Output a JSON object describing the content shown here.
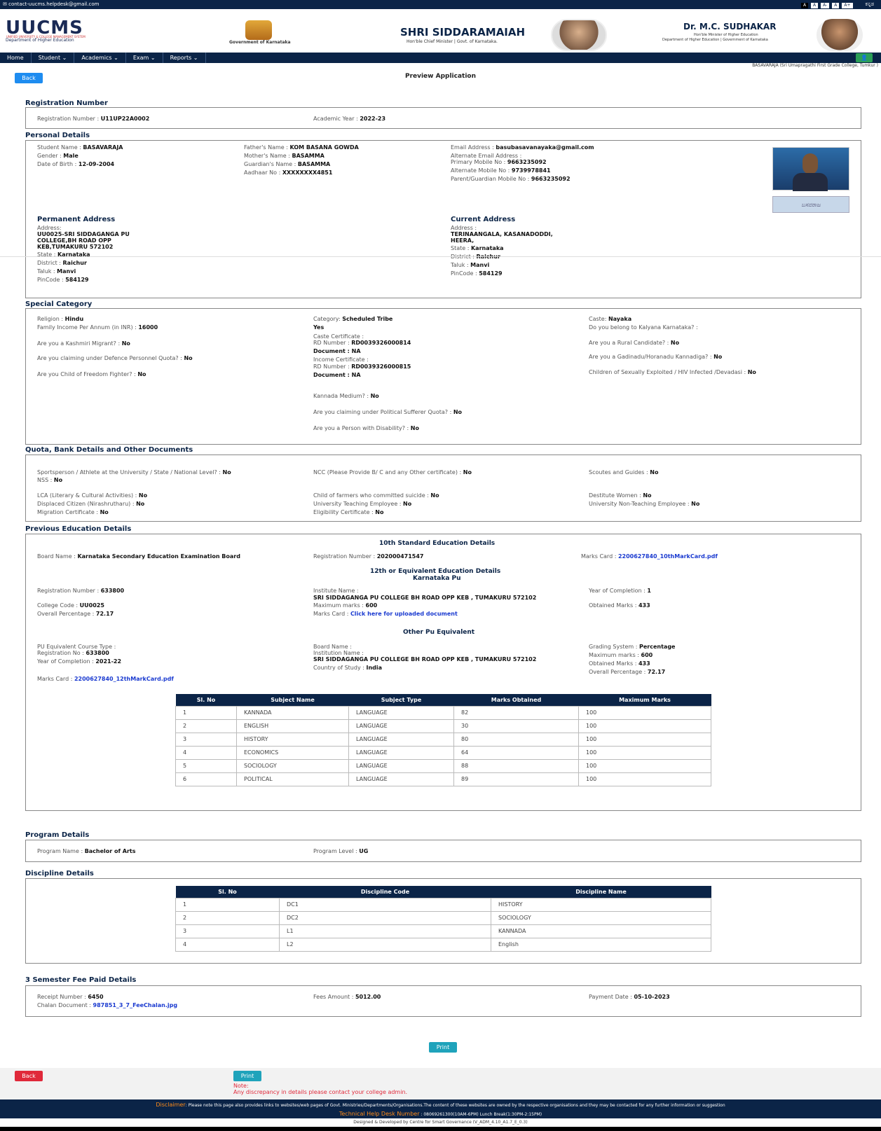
{
  "topbar": {
    "email": "✉ contact-uucms.helpdesk@gmail.com",
    "font_buttons": [
      "A",
      "A",
      "A",
      "A-",
      "A+"
    ],
    "language": "ಕನ್ನಡ"
  },
  "header": {
    "logo": "UUCMS",
    "logo_tag": "UNIFIED UNIVERSITY & COLLEGE MANAGEMENT SYSTEM",
    "logo_sub": "Department of Higher Education",
    "gov": "Government of Karnataka",
    "cm_name": "SHRI SIDDARAMAIAH",
    "cm_role": "Hon'ble Chief Minister  |  Govt. of Karnataka.",
    "min_name": "Dr. M.C. SUDHAKAR",
    "min_role1": "Hon'ble Minister of Higher Education",
    "min_role2": "Department of Higher Education | Government of Karnataka"
  },
  "nav": {
    "items": [
      "Home",
      "Student ⌄",
      "Academics ⌄",
      "Exam ⌄",
      "Reports ⌄"
    ],
    "user_icon": "👤"
  },
  "college": "BASAVARAJA (Sri Umapragathi First Grade College, Tumkur )",
  "back_label": "Back",
  "page_title": "Preview Application",
  "sections": {
    "reg": "Registration Number",
    "personal": "Personal Details",
    "special": "Special Category",
    "quota": "Quota, Bank Details and Other Documents",
    "prev": "Previous Education Details",
    "program": "Program Details",
    "discipline": "Discipline Details",
    "fee": "3 Semester Fee Paid Details"
  },
  "reg": {
    "reg_label": "Registration Number : ",
    "reg_value": "U11UP22A0002",
    "year_label": "Academic Year : ",
    "year_value": "2022-23"
  },
  "personal": {
    "student_label": "Student Name : ",
    "student_value": "BASAVARAJA",
    "gender_label": "Gender : ",
    "gender_value": "Male",
    "dob_label": "Date of Birth : ",
    "dob_value": "12-09-2004",
    "father_label": "Father's Name : ",
    "father_value": "KOM BASANA GOWDA",
    "mother_label": "Mother's Name : ",
    "mother_value": "BASAMMA",
    "guardian_label": "Guardian's Name : ",
    "guardian_value": "BASAMMA",
    "aadhaar_label": "Aadhaar No : ",
    "aadhaar_value": "XXXXXXXX4851",
    "email_label": "Email Address : ",
    "email_value": "basubasavanayaka@gmail.com",
    "alt_email_label": "Alternate Email Address :",
    "primary_label": "Primary Mobile No : ",
    "primary_value": "9663235092",
    "alt_mobile_label": "Alternate Mobile No : ",
    "alt_mobile_value": "9739978841",
    "parent_label": "Parent/Guardian Mobile No : ",
    "parent_value": "9663235092",
    "signature": "ಬಸವರಾಜ"
  },
  "permanent": {
    "heading": "Permanent Address",
    "address_label": "Address:",
    "line1": "UU0025-SRI SIDDAGANGA PU",
    "line2": "COLLEGE,BH ROAD OPP",
    "line3": "KEB,TUMAKURU 572102",
    "state_label": "State : ",
    "state": "Karnataka",
    "district_label": "District : ",
    "district": "Raichur",
    "taluk_label": "Taluk : ",
    "taluk": "Manvi",
    "pin_label": "PinCode : ",
    "pin": "584129"
  },
  "current": {
    "heading": "Current Address",
    "address_label": "Address :",
    "line1": "TERINAANGALA, KASANADODDI,",
    "line2": "HEERA,",
    "state_label": "State : ",
    "state": "Karnataka",
    "district_label": "District : ",
    "district": "Raichur",
    "taluk_label": "Taluk : ",
    "taluk": "Manvi",
    "pin_label": "PinCode : ",
    "pin": "584129"
  },
  "special": {
    "religion_label": "Religion : ",
    "religion": "Hindu",
    "income_label": "Family Income Per Annum (in INR) : ",
    "income": "16000",
    "kashmiri_label": "Are you a Kashmiri Migrant? : ",
    "kashmiri": "No",
    "defence_label": "Are you claiming under Defence Personnel Quota? : ",
    "defence": "No",
    "freedom_label": "Are you Child of Freedom Fighter? : ",
    "freedom": "No",
    "category_label": "Category: ",
    "category": "Scheduled Tribe",
    "yes": "Yes",
    "caste_cert": "Caste Certificate :",
    "rd_label": "RD Number : ",
    "rd1": "RD0039326000814",
    "doc_label": "Document : ",
    "doc_value": "NA",
    "income_cert": "Income Certificate :",
    "rd2": "RD0039326000815",
    "kannada_label": "Kannada Medium? : ",
    "kannada": "No",
    "political_label": "Are you claiming under Political Sufferer Quota? : ",
    "political": "No",
    "disability_label": "Are you a Person with Disability? : ",
    "disability": "No",
    "caste_label": "Caste: ",
    "caste": "Nayaka",
    "kalyana_label": "Do you belong to Kalyana Karnataka? :",
    "rural_label": "Are you a Rural Candidate? : ",
    "rural": "No",
    "gadinadu_label": "Are you a Gadinadu/Horanadu Kannadiga? : ",
    "gadinadu": "No",
    "exploited_label": "Children of Sexually Exploited / HIV Infected /Devadasi : ",
    "exploited": "No"
  },
  "quota": {
    "sports_label": "Sportsperson / Athlete at the University / State / National Level? : ",
    "sports": "No",
    "nss_label": "NSS : ",
    "nss": "No",
    "ncc_label": "NCC (Please Provide B/ C and any Other certificate) : ",
    "ncc": "No",
    "scouts_label": "Scoutes and Guides : ",
    "scouts": "No",
    "lca_label": "LCA (Literary & Cultural Activities) : ",
    "lca": "No",
    "displaced_label": "Displaced Citizen (Nirashrutharu) : ",
    "displaced": "No",
    "migration_label": "Migration Certificate : ",
    "migration": "No",
    "farmers_label": "Child of farmers who committed suicide : ",
    "farmers": "No",
    "teaching_label": "University Teaching Employee : ",
    "teaching": "No",
    "eligibility_label": "Eligibility Certificate : ",
    "eligibility": "No",
    "destitute_label": "Destitute Women : ",
    "destitute": "No",
    "nonteaching_label": "University Non-Teaching Employee : ",
    "nonteaching": "No"
  },
  "prev": {
    "tenth_heading": "10th Standard Education Details",
    "board_label": "Board Name : ",
    "board": "Karnataka Secondary Education Examination Board",
    "reg10_label": "Registration Number : ",
    "reg10": "202000471547",
    "marks10_label": "Marks Card : ",
    "marks10": "2200627840_10thMarkCard.pdf",
    "twelfth_heading": "12th or Equivalent Education Details",
    "twelfth_sub": "Karnataka Pu",
    "reg12_label": "Registration Number : ",
    "reg12": "633800",
    "college_code_label": "College Code : ",
    "college_code": "UU0025",
    "overall_label": "Overall Percentage : ",
    "overall": "72.17",
    "inst_label": "Institute Name :",
    "inst": "SRI SIDDAGANGA PU COLLEGE BH ROAD OPP KEB , TUMAKURU 572102",
    "max_label": "Maximum marks : ",
    "max": "600",
    "marks12_label": "Marks Card : ",
    "marks12": "Click here for uploaded document",
    "yoc_label": "Year of Completion : ",
    "yoc": "1",
    "obt_label": "Obtained Marks : ",
    "obt": "433",
    "other_heading": "Other Pu Equivalent",
    "pu_course_label": "PU Equivalent Course Type :",
    "regno_label": "Registration No : ",
    "regno": "633800",
    "yoc2_label": "Year of Completion : ",
    "yoc2": "2021-22",
    "marks_other_label": "Marks Card : ",
    "marks_other": "2200627840_12thMarkCard.pdf",
    "board2_label": "Board Name :",
    "inst2_label": "Institution Name :",
    "inst2": "SRI SIDDAGANGA PU COLLEGE BH ROAD OPP KEB , TUMAKURU 572102",
    "country_label": "Country of Study : ",
    "country": "India",
    "grading_label": "Grading System : ",
    "grading": "Percentage",
    "max2_label": "Maximum marks : ",
    "max2": "600",
    "obt2_label": "Obtained Marks : ",
    "obt2": "433",
    "overall2_label": "Overall Percentage : ",
    "overall2": "72.17",
    "table_headers": [
      "Sl. No",
      "Subject Name",
      "Subject Type",
      "Marks Obtained",
      "Maximum Marks"
    ],
    "rows": [
      [
        "1",
        "KANNADA",
        "LANGUAGE",
        "82",
        "100"
      ],
      [
        "2",
        "ENGLISH",
        "LANGUAGE",
        "30",
        "100"
      ],
      [
        "3",
        "HISTORY",
        "LANGUAGE",
        "80",
        "100"
      ],
      [
        "4",
        "ECONOMICS",
        "LANGUAGE",
        "64",
        "100"
      ],
      [
        "5",
        "SOCIOLOGY",
        "LANGUAGE",
        "88",
        "100"
      ],
      [
        "6",
        "POLITICAL",
        "LANGUAGE",
        "89",
        "100"
      ]
    ]
  },
  "program": {
    "name_label": "Program Name : ",
    "name": "Bachelor of Arts",
    "level_label": "Program Level : ",
    "level": "UG"
  },
  "discipline": {
    "headers": [
      "Sl. No",
      "Discipline Code",
      "Discipline Name"
    ],
    "rows": [
      [
        "1",
        "DC1",
        "HISTORY"
      ],
      [
        "2",
        "DC2",
        "SOCIOLOGY"
      ],
      [
        "3",
        "L1",
        "KANNADA"
      ],
      [
        "4",
        "L2",
        "English"
      ]
    ]
  },
  "fee": {
    "receipt_label": "Receipt Number : ",
    "receipt": "6450",
    "chalan_label": "Chalan Document : ",
    "chalan": "987851_3_7_FeeChalan.jpg",
    "amount_label": "Fees Amount : ",
    "amount": "5012.00",
    "date_label": "Payment Date : ",
    "date": "05-10-2023"
  },
  "print_label": "Print",
  "note_label": "Note:",
  "note_text": "Any discrepancy in details please contact your college admin.",
  "footer": {
    "disc_label": "Disclaimer",
    "disc_text": ": Please note this page also provides links to websites/web pages of Govt. Ministries/Departments/Organisations.The content of these websites are owned by the respective organisations and they may be contacted for any further information or suggestion",
    "help_label": "Technical Help Desk Number",
    "help_text": " : 08069261300(10AM-6PM) Lunch Break(1:30PM-2:15PM)",
    "credit": "Designed & Developed by Centre for Smart Governance (V_ADM_4.10_A1.7_E_0.3)"
  }
}
